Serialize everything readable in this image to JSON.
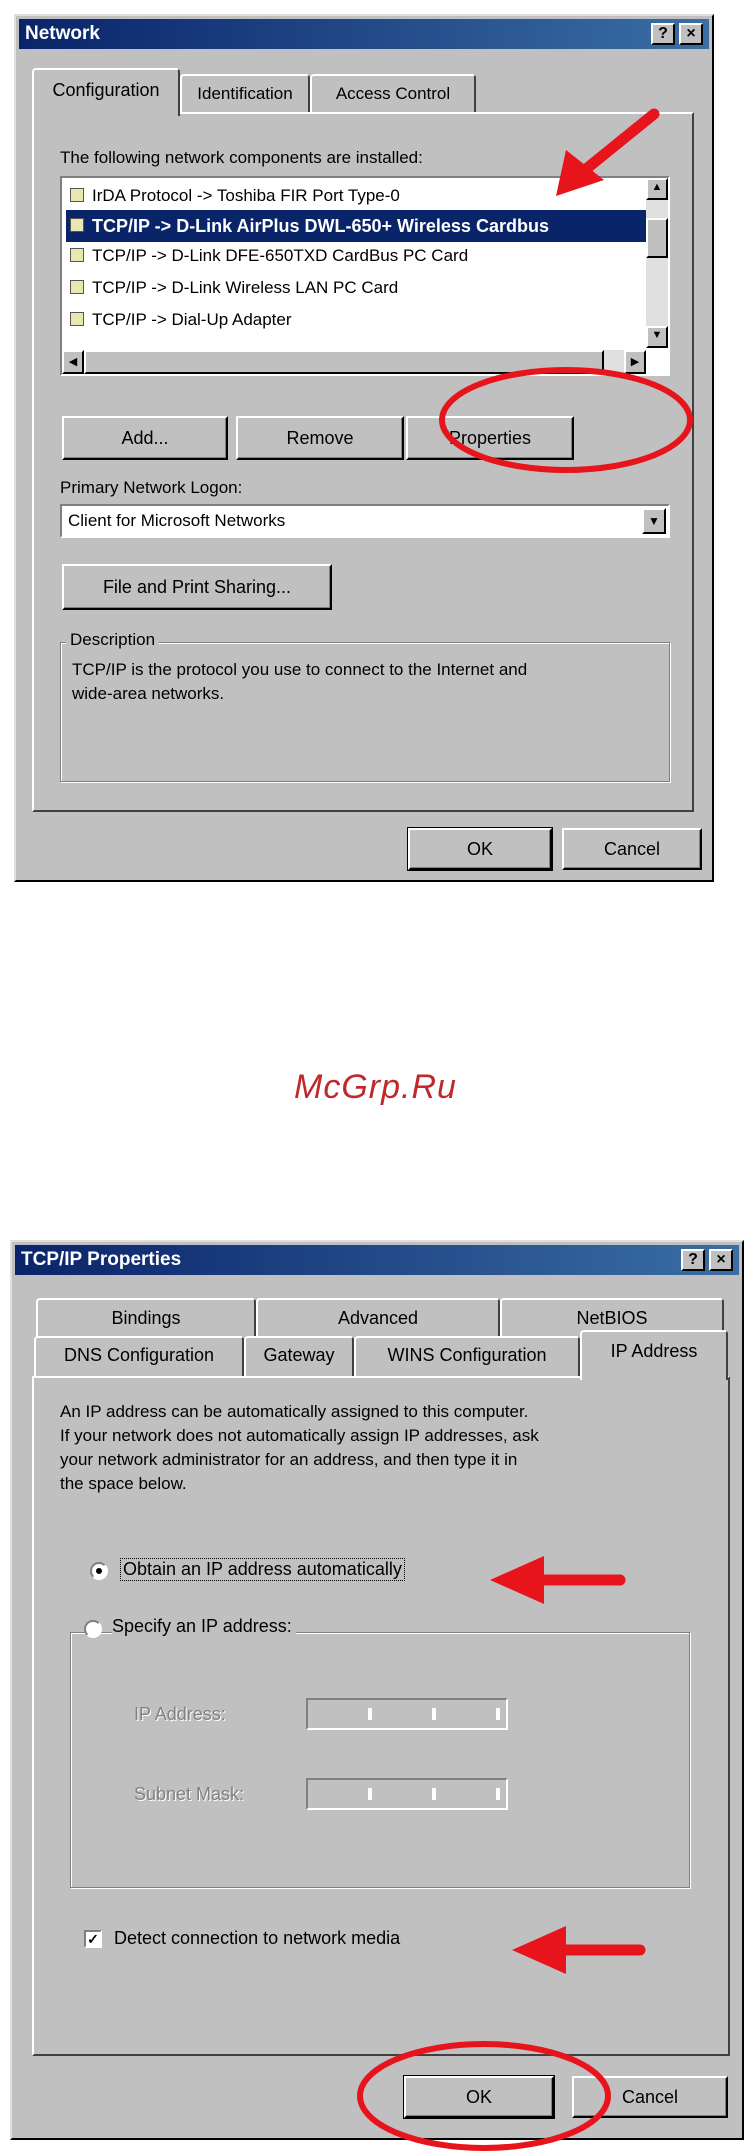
{
  "network": {
    "title": "Network",
    "help_btn": "?",
    "close_btn": "×",
    "tabs": [
      "Configuration",
      "Identification",
      "Access Control"
    ],
    "components_label": "The following network components are installed:",
    "components": [
      "IrDA Protocol -> Toshiba FIR Port Type-0",
      "TCP/IP -> D-Link AirPlus DWL-650+ Wireless Cardbus",
      "TCP/IP -> D-Link DFE-650TXD CardBus PC Card",
      "TCP/IP -> D-Link Wireless LAN PC Card",
      "TCP/IP -> Dial-Up Adapter"
    ],
    "selected_index": 1,
    "buttons": {
      "add": "Add...",
      "remove": "Remove",
      "properties": "Properties"
    },
    "logon_label": "Primary Network Logon:",
    "logon_value": "Client for Microsoft Networks",
    "file_share": "File and Print Sharing...",
    "description_label": "Description",
    "description_text_1": "TCP/IP is the protocol you use to connect to the Internet and",
    "description_text_2": "wide-area networks.",
    "ok": "OK",
    "cancel": "Cancel"
  },
  "watermark": "McGrp.Ru",
  "tcpip": {
    "title": "TCP/IP Properties",
    "help_btn": "?",
    "close_btn": "×",
    "tabs_back": [
      "Bindings",
      "Advanced",
      "NetBIOS"
    ],
    "tabs_front": [
      "DNS Configuration",
      "Gateway",
      "WINS Configuration",
      "IP Address"
    ],
    "intro_1": "An IP address can be automatically assigned to this computer.",
    "intro_2": "If your network does not automatically assign IP addresses, ask",
    "intro_3": "your network administrator for an address, and then type it in",
    "intro_4": "the space below.",
    "obtain_label": "Obtain an IP address automatically",
    "specify_label": "Specify an IP address:",
    "ip_label": "IP Address:",
    "mask_label": "Subnet Mask:",
    "detect_label": "Detect connection to network media",
    "ok": "OK",
    "cancel": "Cancel"
  },
  "colors": {
    "annotation": "#e8141c",
    "titlebar": "#0a246a",
    "face": "#c0c0c0"
  }
}
